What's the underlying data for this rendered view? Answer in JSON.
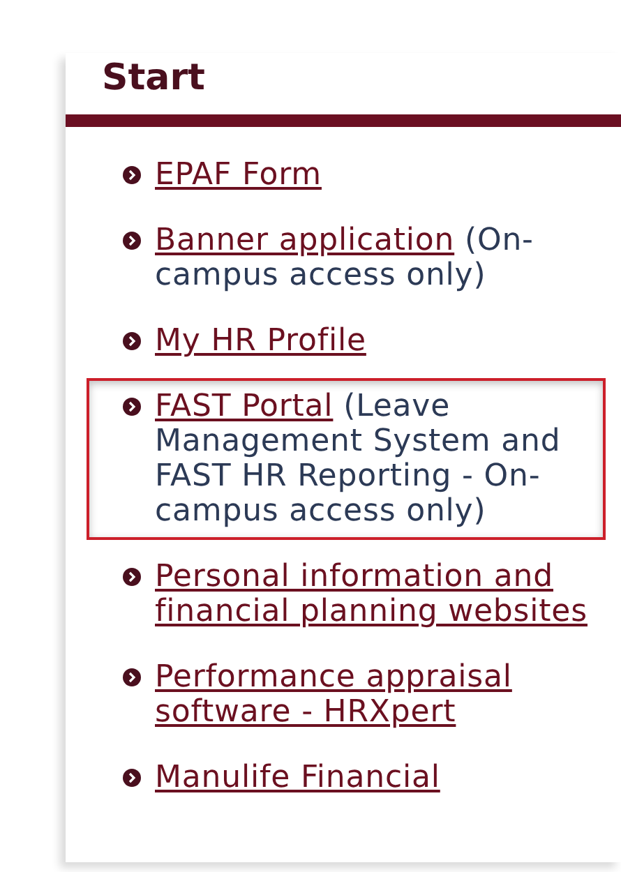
{
  "heading": "Start",
  "items": [
    {
      "link": "EPAF Form",
      "highlighted": false
    },
    {
      "link": "Banner application",
      "note": "(On-campus access only)",
      "highlighted": false
    },
    {
      "link": "My HR Profile",
      "highlighted": false
    },
    {
      "link": "FAST Portal",
      "note": "(Leave Management System and FAST HR Reporting - On-campus access only)",
      "highlighted": true
    },
    {
      "link": "Personal information and financial planning websites",
      "highlighted": false
    },
    {
      "link": "Performance appraisal software - HRXpert",
      "highlighted": false
    },
    {
      "link": "Manulife Financial",
      "highlighted": false
    }
  ]
}
